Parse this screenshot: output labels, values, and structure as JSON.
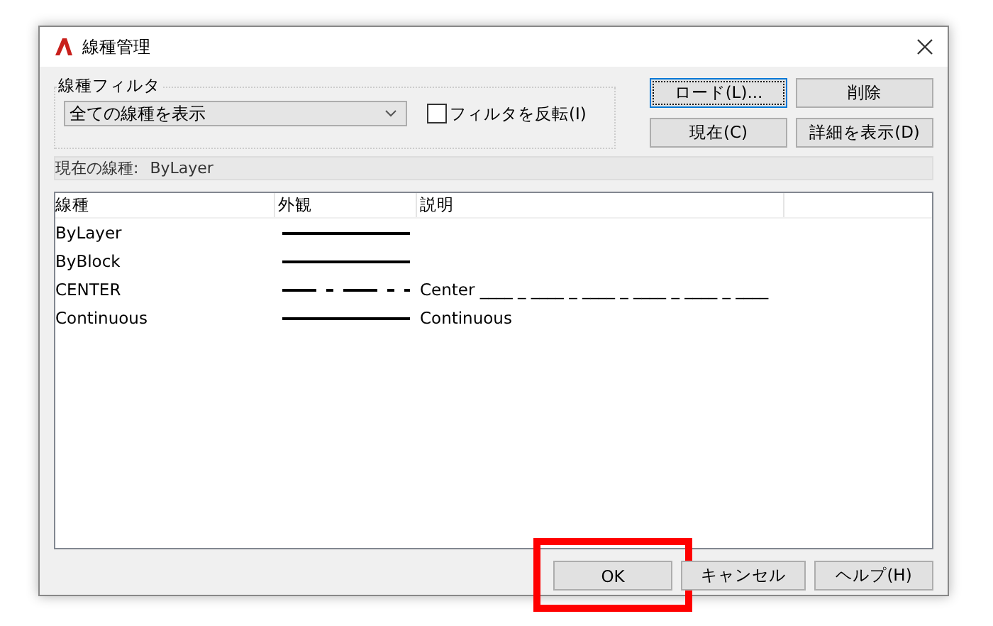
{
  "window": {
    "title": "線種管理"
  },
  "filter": {
    "label": "線種フィルタ",
    "value": "全ての線種を表示",
    "invert": {
      "label": "フィルタを反転(I)",
      "checked": false
    }
  },
  "top_buttons": [
    {
      "label": "ロード(L)...",
      "focused": true
    },
    {
      "label": "削除",
      "focused": false
    },
    {
      "label": "現在(C)",
      "focused": false
    },
    {
      "label": "詳細を表示(D)",
      "focused": false
    }
  ],
  "current": {
    "label": "現在の線種:",
    "value": "ByLayer"
  },
  "table": {
    "columns": [
      "線種",
      "外観",
      "説明"
    ],
    "rows": [
      {
        "name": "ByLayer",
        "kind": "solid"
      },
      {
        "name": "ByBlock",
        "kind": "solid"
      },
      {
        "name": "CENTER",
        "kind": "center",
        "description": "Center ____ _ ____ _ ____ _ ____ _ ____ _ ____"
      },
      {
        "name": "Continuous",
        "kind": "solid",
        "description": "Continuous"
      }
    ]
  },
  "bottom_buttons": [
    {
      "label": "OK",
      "highlighted": true
    },
    {
      "label": "キャンセル",
      "highlighted": false
    },
    {
      "label": "ヘルプ(H)",
      "highlighted": false
    }
  ]
}
